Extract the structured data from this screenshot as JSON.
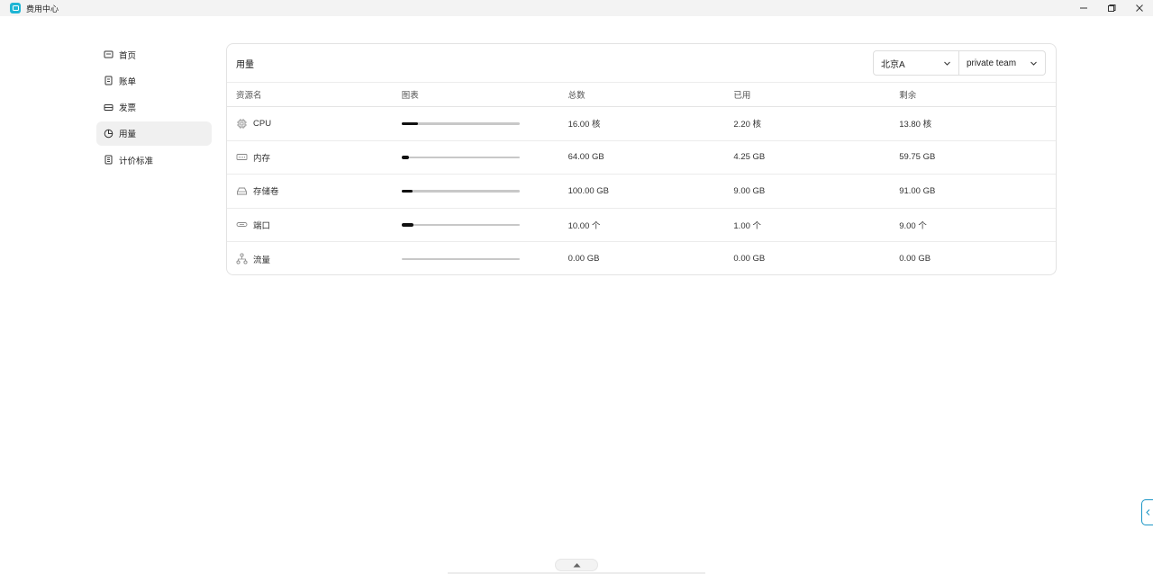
{
  "window": {
    "title": "费用中心",
    "controls": [
      "minimize-icon",
      "restore-icon",
      "close-icon"
    ]
  },
  "sidebar": {
    "items": [
      {
        "label": "首页",
        "icon": "home-icon",
        "active": false
      },
      {
        "label": "账单",
        "icon": "bill-icon",
        "active": false
      },
      {
        "label": "发票",
        "icon": "invoice-icon",
        "active": false
      },
      {
        "label": "用量",
        "icon": "usage-pie-icon",
        "active": true
      },
      {
        "label": "计价标准",
        "icon": "pricing-icon",
        "active": false
      }
    ]
  },
  "panel": {
    "title": "用量",
    "region_select": "北京A",
    "team_select": "private team",
    "columns": [
      "资源名",
      "图表",
      "总数",
      "已用",
      "剩余"
    ],
    "rows": [
      {
        "name": "CPU",
        "icon": "cpu-icon",
        "total": "16.00 核",
        "used": "2.20 核",
        "remaining": "13.80 核",
        "usage_fraction": 0.1375
      },
      {
        "name": "内存",
        "icon": "memory-icon",
        "total": "64.00 GB",
        "used": "4.25 GB",
        "remaining": "59.75 GB",
        "usage_fraction": 0.066
      },
      {
        "name": "存储卷",
        "icon": "storage-icon",
        "total": "100.00 GB",
        "used": "9.00 GB",
        "remaining": "91.00 GB",
        "usage_fraction": 0.09
      },
      {
        "name": "端口",
        "icon": "port-icon",
        "total": "10.00 个",
        "used": "1.00 个",
        "remaining": "9.00 个",
        "usage_fraction": 0.1
      },
      {
        "name": "流量",
        "icon": "traffic-icon",
        "total": "0.00 GB",
        "used": "0.00 GB",
        "remaining": "0.00 GB",
        "usage_fraction": 0
      }
    ]
  },
  "colors": {
    "accent": "#1fb5d4",
    "bar_fill": "#111111",
    "bar_track": "#c8c8c8",
    "active_nav_bg": "#f0f0f0"
  }
}
